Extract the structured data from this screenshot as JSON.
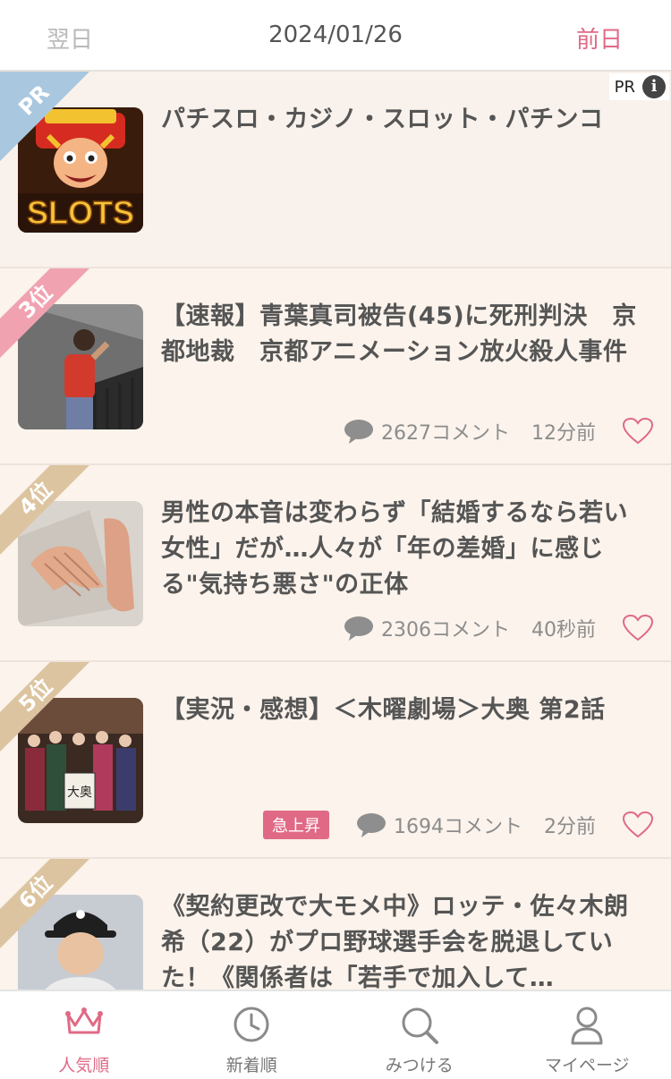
{
  "header": {
    "next_label": "翌日",
    "date": "2024/01/26",
    "prev_label": "前日"
  },
  "colors": {
    "accent": "#e06a86",
    "ribbon_pr": "#a9c8df",
    "ribbon_3": "#f0a2b1",
    "ribbon_rank": "#dcc4a0"
  },
  "items": [
    {
      "ribbon": "PR",
      "title": "パチスロ・カジノ・スロット・パチンコ",
      "pr_label": "PR",
      "info_icon": "info-icon",
      "thumb_text": "SLOTS"
    },
    {
      "ribbon": "3位",
      "title": "【速報】青葉真司被告(45)に死刑判決　京都地裁　京都アニメーション放火殺人事件",
      "comments": "2627コメント",
      "ago": "12分前"
    },
    {
      "ribbon": "4位",
      "title": "男性の本音は変わらず「結婚するなら若い女性」だが…人々が「年の差婚」に感じる\"気持ち悪さ\"の正体",
      "comments": "2306コメント",
      "ago": "40秒前"
    },
    {
      "ribbon": "5位",
      "title": "【実況・感想】＜木曜劇場＞大奥 第2話",
      "badge": "急上昇",
      "comments": "1694コメント",
      "ago": "2分前",
      "thumb_text": "大奥"
    },
    {
      "ribbon": "6位",
      "title": "《契約更改で大モメ中》ロッテ・佐々木朗希（22）がプロ野球選手会を脱退していた！《関係者は「若手で加入して…"
    }
  ],
  "tabs": [
    {
      "label": "人気順",
      "icon": "crown-icon",
      "active": true
    },
    {
      "label": "新着順",
      "icon": "clock-icon",
      "active": false
    },
    {
      "label": "みつける",
      "icon": "search-icon",
      "active": false
    },
    {
      "label": "マイページ",
      "icon": "person-icon",
      "active": false
    }
  ]
}
